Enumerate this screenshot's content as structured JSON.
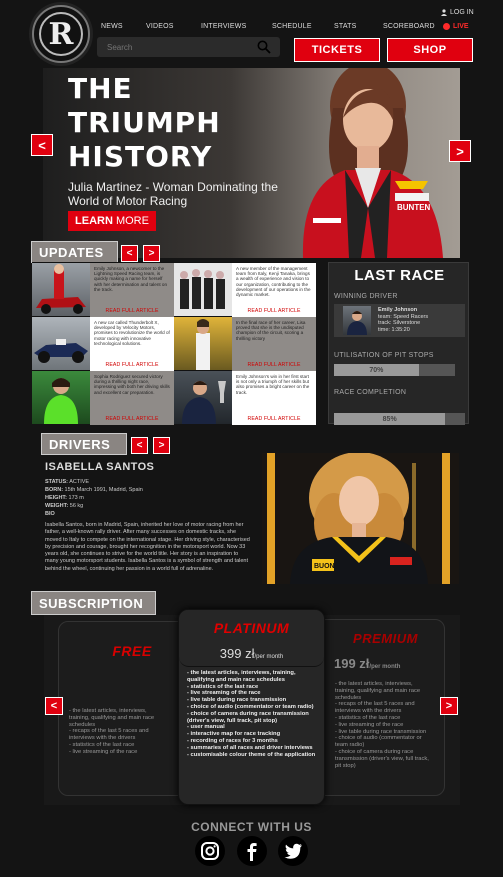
{
  "header": {
    "logo_letter": "R",
    "nav": [
      "NEWS",
      "VIDEOS",
      "INTERVIEWS",
      "SCHEDULE",
      "STATS",
      "SCOREBOARD"
    ],
    "login": "LOG IN",
    "live": "LIVE",
    "search_placeholder": "Search",
    "tickets": "TICKETS",
    "shop": "SHOP"
  },
  "hero": {
    "title_lines": [
      "THE",
      "TRIUMPH",
      "HISTORY"
    ],
    "subtitle": "Julia Martinez - Woman Dominating the World of Motor Racing",
    "learn_bold": "LEARN",
    "learn_rest": " MORE",
    "helmet_brand": "BUNTEN",
    "arrow_left": "<",
    "arrow_right": ">"
  },
  "updates": {
    "title": "UPDATES",
    "read_label": "READ FULL ARTICLE",
    "articles": [
      {
        "text": "Emily Johnson, a newcomer to the Lightning Speed Racing team, is quickly making a name for herself with her determination and talent on the track."
      },
      {
        "text": "A new member of the management team from Italy, Kenji Tanaka, brings a wealth of experience and vision to our organization, contributing to the development of our operations in the dynamic market."
      },
      {
        "text": "A new car called Thunderbolt X, developed by Velocity Motors, promises to revolutionize the world of motor racing with innovative technological solutions."
      },
      {
        "text": "In the final race of her career, Lisa proved that she is the undisputed champion of the circuit, scoring a thrilling victory"
      },
      {
        "text": "Sophia Rodriguez secured victory during a thrilling night race, impressing with both her driving skills and excellent car preparation."
      },
      {
        "text": "Emily Johnson's win in her first start is not only a triumph of her skills but also promises a bright career on the track."
      }
    ]
  },
  "last_race": {
    "title": "LAST RACE",
    "winning_label": "WINNING DRIVER",
    "winner_name": "Emily Johnson",
    "winner_team": "team: Speed Racers",
    "winner_track": "track: Silverstone",
    "winner_time": "time: 1:35:20",
    "pit_label": "UTILISATION OF PIT STOPS",
    "pit_value": "70%",
    "pit_fraction": 0.7,
    "completion_label": "RACE COMPLETION",
    "completion_value": "85%",
    "completion_fraction": 0.85
  },
  "drivers": {
    "title": "DRIVERS",
    "name": "ISABELLA SANTOS",
    "status_label": "STATUS:",
    "status": " ACTIVE",
    "born_label": "BORN:",
    "born": " 15th March 1991, Madrid, Spain",
    "height_label": "HEIGHT:",
    "height": " 173 m",
    "weight_label": "WEIGHT:",
    "weight": " 56 kg",
    "bio_label": "BIO",
    "bio": "Isabella Santos, born in Madrid, Spain, inherited her love of motor racing from her father, a well-known rally driver. After many successes on domestic tracks, she moved to Italy to compete on the international stage. Her driving style, characterised by precision and courage, brought her recognition in the motorsport world. Now 33 years old, she continues to strive for the world title. Her story is an inspiration to many young motorsport students. Isabella Santos is a symbol of strength and talent behind the wheel, continuing her passion in a world full of adrenaline.",
    "suit_text": "BUON"
  },
  "subscription": {
    "title": "SUBSCRIPTION",
    "free": {
      "name": "FREE",
      "features": [
        "the latest articles, interviews, training, qualifying and main race schedules",
        "recaps of the last 5 races and interviews with the drivers",
        "statistics of the last race",
        "live streaming of the race"
      ]
    },
    "platinum": {
      "name": "PLATINUM",
      "price": "399 zł",
      "per": "/per month",
      "features": [
        "the latest articles, interviews, training, qualifying and main race schedules",
        "statistics of the last race",
        "live streaming of the race",
        "live table during race transmission",
        "choice of audio (commentator or team radio)",
        "choice of camera during race transmission (driver's view, full track, pit stop)",
        "user manual",
        "interactive map for race tracking",
        "recording of races for 3 months",
        "summaries of all races and driver interviews",
        "customisable colour theme of the application"
      ]
    },
    "premium": {
      "name": "PREMIUM",
      "price": "199 zł",
      "per": "/per month",
      "features": [
        "the latest articles, interviews, training, qualifying and main race schedules",
        "recaps of the last 5 races and interviews with the drivers",
        "statistics of the last race",
        "live streaming of the race",
        "live table during race transmission",
        "choice of audio (commentator or team radio)",
        "choice of camera during race transmission (driver's view, full track, pit stop)"
      ]
    }
  },
  "footer": {
    "connect": "CONNECT WITH US",
    "social_icons": [
      "instagram-icon",
      "facebook-icon",
      "twitter-icon"
    ]
  },
  "colors": {
    "accent": "#e0000f",
    "background": "#141414",
    "panel": "#262626"
  }
}
